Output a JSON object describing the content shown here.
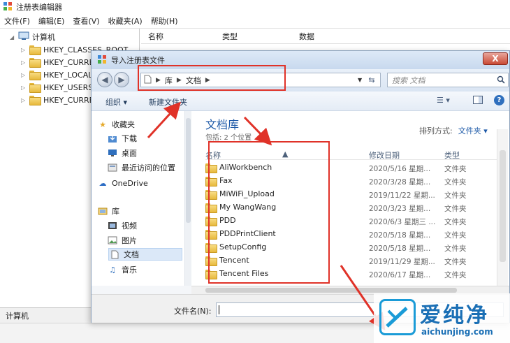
{
  "regedit": {
    "title": "注册表编辑器",
    "menu": [
      "文件(F)",
      "编辑(E)",
      "查看(V)",
      "收藏夹(A)",
      "帮助(H)"
    ],
    "tree_root": "计算机",
    "tree_keys": [
      "HKEY_CLASSES_ROOT",
      "HKEY_CURRE",
      "HKEY_LOCAL",
      "HKEY_USERS",
      "HKEY_CURRE"
    ],
    "columns": {
      "name": "名称",
      "type": "类型",
      "data": "数据"
    },
    "statusbar": "计算机"
  },
  "dialog": {
    "title": "导入注册表文件",
    "close_label": "X",
    "breadcrumb": [
      "库",
      "文档"
    ],
    "search_placeholder": "搜索 文档",
    "toolbar": {
      "organize": "组织 ▾",
      "new_folder": "新建文件夹"
    },
    "nav": {
      "favorites_header": "收藏夹",
      "favorites": [
        "下载",
        "桌面",
        "最近访问的位置"
      ],
      "onedrive": "OneDrive",
      "libraries_header": "库",
      "libraries": [
        "视频",
        "图片",
        "文档",
        "音乐"
      ]
    },
    "library": {
      "title": "文档库",
      "subtitle": "包括: 2 个位置",
      "arrange_label": "排列方式:",
      "arrange_value": "文件夹 ▾"
    },
    "columns": {
      "name": "名称",
      "date": "修改日期",
      "type": "类型"
    },
    "files": [
      {
        "name": "AliWorkbench",
        "date": "2020/5/16 星期...",
        "type": "文件夹"
      },
      {
        "name": "Fax",
        "date": "2020/3/28 星期...",
        "type": "文件夹"
      },
      {
        "name": "MiWiFi_Upload",
        "date": "2019/11/22 星期...",
        "type": "文件夹"
      },
      {
        "name": "My WangWang",
        "date": "2020/3/23 星期...",
        "type": "文件夹"
      },
      {
        "name": "PDD",
        "date": "2020/6/3 星期三 ...",
        "type": "文件夹"
      },
      {
        "name": "PDDPrintClient",
        "date": "2020/5/18 星期...",
        "type": "文件夹"
      },
      {
        "name": "SetupConfig",
        "date": "2020/5/18 星期...",
        "type": "文件夹"
      },
      {
        "name": "Tencent",
        "date": "2019/11/29 星期...",
        "type": "文件夹"
      },
      {
        "name": "Tencent Files",
        "date": "2020/6/17 星期...",
        "type": "文件夹"
      }
    ],
    "filename_label": "文件名(N):",
    "filename_value": ""
  },
  "watermark": {
    "text": "爱纯净",
    "url": "aichunjing.com"
  },
  "colors": {
    "annotation_red": "#e03228",
    "library_blue": "#1e5aa8",
    "titlebar_blue": "#c8d9ee"
  },
  "icons": [
    "registry-icon",
    "computer-icon",
    "folder-icon",
    "star-icon",
    "download-icon",
    "desktop-icon",
    "recent-icon",
    "cloud-icon",
    "library-icon",
    "video-icon",
    "picture-icon",
    "document-icon",
    "music-icon",
    "search-icon",
    "refresh-icon",
    "help-icon",
    "view-icon",
    "preview-pane-icon",
    "back-icon",
    "forward-icon"
  ]
}
